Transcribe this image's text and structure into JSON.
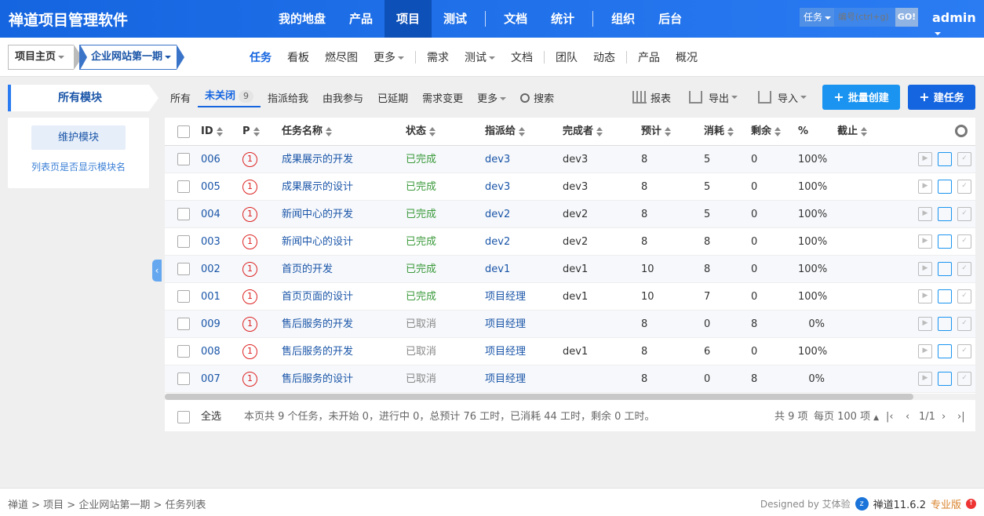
{
  "brand": "禅道项目管理软件",
  "main_nav": [
    "我的地盘",
    "产品",
    "项目",
    "测试",
    "文档",
    "统计",
    "组织",
    "后台"
  ],
  "main_nav_active": "项目",
  "search": {
    "type": "任务",
    "placeholder": "编号(ctrl+g)",
    "go": "GO!"
  },
  "user": "admin",
  "breadcrumb": {
    "root": "项目主页",
    "current": "企业网站第一期"
  },
  "sub_nav": [
    "任务",
    "看板",
    "燃尽图",
    "更多",
    "需求",
    "测试",
    "文档",
    "团队",
    "动态",
    "产品",
    "概况"
  ],
  "sub_nav_active": "任务",
  "sidebar": {
    "title": "所有模块",
    "maintain": "维护模块",
    "show_module": "列表页是否显示模块名"
  },
  "filters": {
    "all": "所有",
    "unclosed": "未关闭",
    "unclosed_count": "9",
    "assigned": "指派给我",
    "involved": "由我参与",
    "delayed": "已延期",
    "story_changed": "需求变更",
    "more": "更多",
    "search": "搜索"
  },
  "toolbar": {
    "report": "报表",
    "export": "导出",
    "import": "导入",
    "batch_create": "批量创建",
    "create": "建任务"
  },
  "columns": {
    "id": "ID",
    "pri": "P",
    "name": "任务名称",
    "status": "状态",
    "assigned": "指派给",
    "finished": "完成者",
    "estimate": "预计",
    "consumed": "消耗",
    "left": "剩余",
    "progress": "%",
    "deadline": "截止"
  },
  "rows": [
    {
      "id": "006",
      "pri": "1",
      "name": "成果展示的开发",
      "status": "已完成",
      "assigned": "dev3",
      "finished": "dev3",
      "estimate": "8",
      "consumed": "5",
      "left": "0",
      "progress": "100%"
    },
    {
      "id": "005",
      "pri": "1",
      "name": "成果展示的设计",
      "status": "已完成",
      "assigned": "dev3",
      "finished": "dev3",
      "estimate": "8",
      "consumed": "5",
      "left": "0",
      "progress": "100%"
    },
    {
      "id": "004",
      "pri": "1",
      "name": "新闻中心的开发",
      "status": "已完成",
      "assigned": "dev2",
      "finished": "dev2",
      "estimate": "8",
      "consumed": "5",
      "left": "0",
      "progress": "100%"
    },
    {
      "id": "003",
      "pri": "1",
      "name": "新闻中心的设计",
      "status": "已完成",
      "assigned": "dev2",
      "finished": "dev2",
      "estimate": "8",
      "consumed": "8",
      "left": "0",
      "progress": "100%"
    },
    {
      "id": "002",
      "pri": "1",
      "name": "首页的开发",
      "status": "已完成",
      "assigned": "dev1",
      "finished": "dev1",
      "estimate": "10",
      "consumed": "8",
      "left": "0",
      "progress": "100%"
    },
    {
      "id": "001",
      "pri": "1",
      "name": "首页页面的设计",
      "status": "已完成",
      "assigned": "项目经理",
      "finished": "dev1",
      "estimate": "10",
      "consumed": "7",
      "left": "0",
      "progress": "100%"
    },
    {
      "id": "009",
      "pri": "1",
      "name": "售后服务的开发",
      "status": "已取消",
      "assigned": "项目经理",
      "finished": "",
      "estimate": "8",
      "consumed": "0",
      "left": "8",
      "progress": "0%"
    },
    {
      "id": "008",
      "pri": "1",
      "name": "售后服务的开发",
      "status": "已取消",
      "assigned": "项目经理",
      "finished": "dev1",
      "estimate": "8",
      "consumed": "6",
      "left": "0",
      "progress": "100%"
    },
    {
      "id": "007",
      "pri": "1",
      "name": "售后服务的设计",
      "status": "已取消",
      "assigned": "项目经理",
      "finished": "",
      "estimate": "8",
      "consumed": "0",
      "left": "8",
      "progress": "0%"
    }
  ],
  "footer": {
    "select_all": "全选",
    "summary": "本页共 9 个任务，未开始 0，进行中 0，总预计 76 工时，已消耗 44 工时，剩余 0 工时。",
    "total": "共 9 项",
    "per_page": "每页 100 项",
    "page": "1/1"
  },
  "page_footer": {
    "crumbs": "禅道 > 项目 > 企业网站第一期 > 任务列表",
    "designed": "Designed by 艾体验",
    "version": "禅道11.6.2",
    "edition": "专业版"
  }
}
